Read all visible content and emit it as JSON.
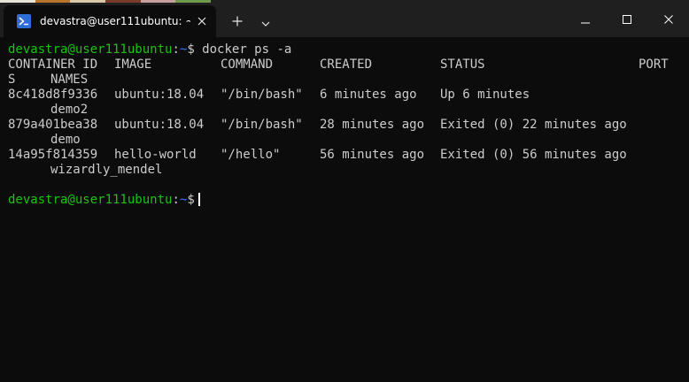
{
  "titlebar": {
    "tab_title": "devastra@user111ubuntu: ~",
    "tab_icon": "powershell-terminal-icon",
    "new_tab_icon": "plus-icon",
    "dropdown_icon": "chevron-down-icon",
    "strip_colors": [
      "#e8e4d8",
      "#b8742a",
      "#d8c9a8",
      "#7a3b2a",
      "#c9a0a0",
      "#6f9a4a"
    ]
  },
  "colors": {
    "prompt_user": "#16c60c",
    "prompt_path": "#3b78ff",
    "text": "#cccccc",
    "background": "#0c0c0c"
  },
  "terminal": {
    "command_prompt": {
      "user": "devastra@user111ubuntu",
      "sep": ":",
      "path": "~",
      "symbol": "$",
      "command": " docker ps -a"
    },
    "header": {
      "container_id": "CONTAINER ID",
      "image": "IMAGE",
      "command": "COMMAND",
      "created": "CREATED",
      "status": "STATUS",
      "ports": "PORT",
      "ports_wrap": "S",
      "names": "NAMES"
    },
    "rows": [
      {
        "container_id": "8c418d8f9336",
        "image": "ubuntu:18.04",
        "command": "\"/bin/bash\"",
        "created": "6 minutes ago",
        "status": "Up 6 minutes",
        "name": "demo2"
      },
      {
        "container_id": "879a401bea38",
        "image": "ubuntu:18.04",
        "command": "\"/bin/bash\"",
        "created": "28 minutes ago",
        "status": "Exited (0) 22 minutes ago",
        "name": "demo"
      },
      {
        "container_id": "14a95f814359",
        "image": "hello-world",
        "command": "\"/hello\"",
        "created": "56 minutes ago",
        "status": "Exited (0) 56 minutes ago",
        "name": "wizardly_mendel"
      }
    ],
    "final_prompt": {
      "user": "devastra@user111ubuntu",
      "sep": ":",
      "path": "~",
      "symbol": "$"
    }
  }
}
